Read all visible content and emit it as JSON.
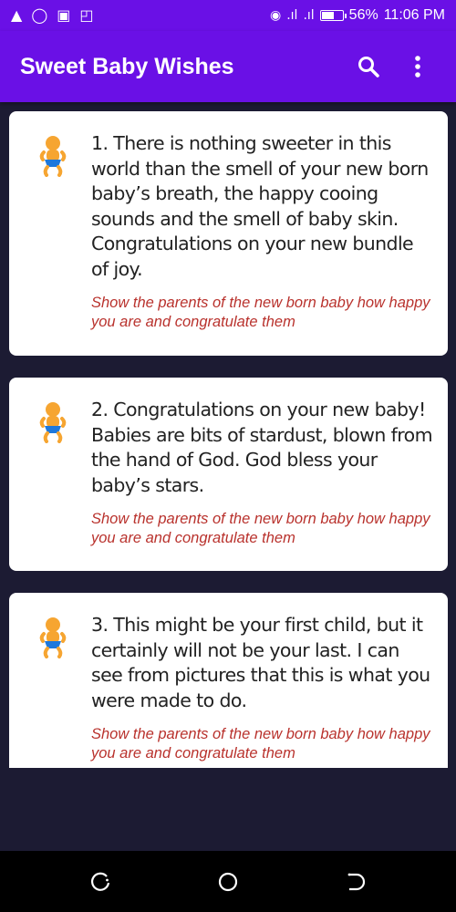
{
  "status_bar": {
    "left_icons": [
      "alert-icon",
      "whatsapp-icon",
      "image-icon",
      "screenshot-icon"
    ],
    "battery_percent": "56%",
    "time": "11:06 PM"
  },
  "app_bar": {
    "title": "Sweet Baby Wishes",
    "search_icon": "search-icon",
    "more_icon": "more-vert-icon"
  },
  "colors": {
    "primary": "#6a10e6",
    "background": "#1c1b33",
    "subtitle": "#b9322d"
  },
  "wishes": [
    {
      "text": "1. There is nothing sweeter in this world than the smell of your new born baby’s breath, the happy cooing sounds and the smell of baby skin. Congratulations on your new bundle of joy.",
      "subtitle": "Show the parents of the new born baby how happy you are and congratulate them"
    },
    {
      "text": "2. Congratulations on your new baby! Babies are bits of stardust, blown from the hand of God. God bless your baby’s stars.",
      "subtitle": "Show the parents of the new born baby how happy you are and congratulate them"
    },
    {
      "text": "3. This might be your first child, but it certainly will not be your last. I can see from pictures that this is what you were made to do.",
      "subtitle": "Show the parents of the new born baby how happy you are and congratulate them"
    }
  ],
  "nav_bar": {
    "buttons": [
      "recents-icon",
      "home-icon",
      "back-icon"
    ]
  }
}
